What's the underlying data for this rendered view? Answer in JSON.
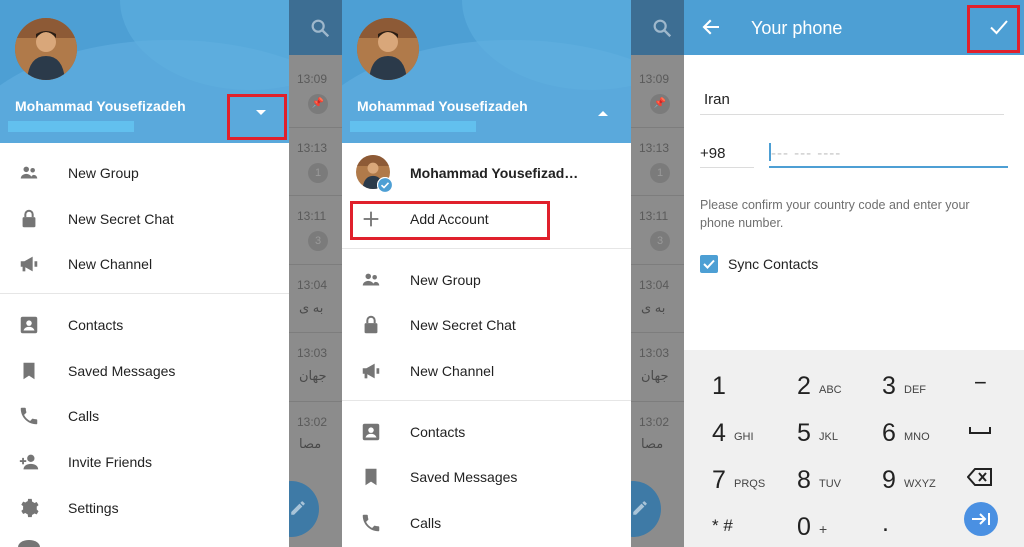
{
  "panel1": {
    "drawer": {
      "user_name": "Mohammad Yousefizadeh",
      "menu": [
        {
          "label": "New Group",
          "icon": "group-icon"
        },
        {
          "label": "New Secret Chat",
          "icon": "lock-icon"
        },
        {
          "label": "New Channel",
          "icon": "megaphone-icon"
        },
        {
          "label": "Contacts",
          "icon": "contact-card-icon"
        },
        {
          "label": "Saved Messages",
          "icon": "bookmark-icon"
        },
        {
          "label": "Calls",
          "icon": "phone-icon"
        },
        {
          "label": "Invite Friends",
          "icon": "add-person-icon"
        },
        {
          "label": "Settings",
          "icon": "gear-icon"
        }
      ]
    },
    "background_chats": {
      "times": [
        "13:09",
        "13:13",
        "13:11",
        "13:04",
        "13:03",
        "13:02"
      ],
      "badges": [
        "1",
        "3"
      ],
      "snippets": [
        "به ی",
        "جهان",
        "مصا"
      ]
    }
  },
  "panel2": {
    "drawer": {
      "user_name": "Mohammad Yousefizadeh",
      "account_name": "Mohammad Yousefizad…",
      "add_account_label": "Add Account",
      "menu": [
        {
          "label": "New Group",
          "icon": "group-icon"
        },
        {
          "label": "New Secret Chat",
          "icon": "lock-icon"
        },
        {
          "label": "New Channel",
          "icon": "megaphone-icon"
        },
        {
          "label": "Contacts",
          "icon": "contact-card-icon"
        },
        {
          "label": "Saved Messages",
          "icon": "bookmark-icon"
        },
        {
          "label": "Calls",
          "icon": "phone-icon"
        }
      ]
    },
    "background_chats": {
      "times": [
        "13:09",
        "13:13",
        "13:11",
        "13:04",
        "13:03",
        "13:02"
      ],
      "badges": [
        "1",
        "3"
      ],
      "snippets": [
        "به ی",
        "جهان",
        "مصا"
      ]
    }
  },
  "panel3": {
    "title": "Your phone",
    "country": "Iran",
    "country_code": "+98",
    "phone_placeholder": "--- --- ----",
    "hint": "Please confirm your country code and enter your phone number.",
    "sync_contacts_label": "Sync Contacts",
    "sync_contacts_checked": true,
    "keypad": [
      {
        "num": "1",
        "letters": ""
      },
      {
        "num": "2",
        "letters": "ABC"
      },
      {
        "num": "3",
        "letters": "DEF"
      },
      {
        "num": "4",
        "letters": "GHI"
      },
      {
        "num": "5",
        "letters": "JKL"
      },
      {
        "num": "6",
        "letters": "MNO"
      },
      {
        "num": "7",
        "letters": "PRQS"
      },
      {
        "num": "8",
        "letters": "TUV"
      },
      {
        "num": "9",
        "letters": "WXYZ"
      },
      {
        "num": "* #",
        "letters": ""
      },
      {
        "num": "0",
        "letters": "+"
      },
      {
        "num": ".",
        "letters": ""
      }
    ],
    "side_keys": [
      "−",
      "space",
      "backspace",
      "next"
    ]
  },
  "colors": {
    "accent": "#4d9fd4",
    "highlight": "#e0202c",
    "header_bar": "#3d6e93"
  }
}
